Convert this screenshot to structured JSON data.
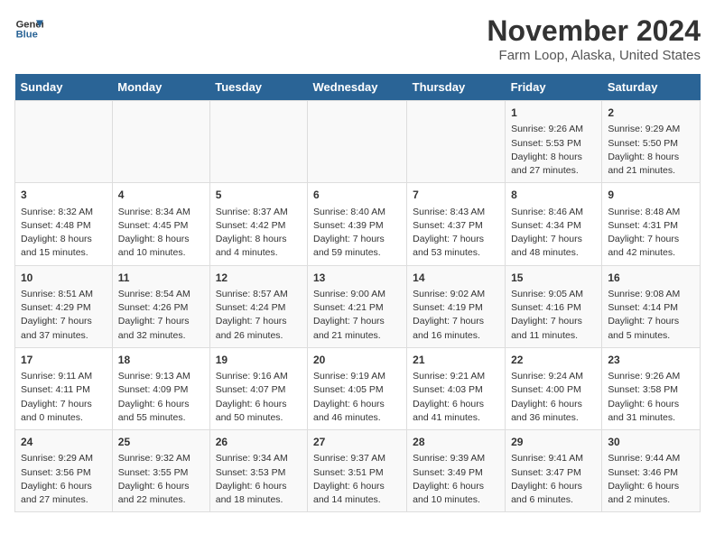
{
  "logo": {
    "line1": "General",
    "line2": "Blue"
  },
  "title": "November 2024",
  "subtitle": "Farm Loop, Alaska, United States",
  "days_header": [
    "Sunday",
    "Monday",
    "Tuesday",
    "Wednesday",
    "Thursday",
    "Friday",
    "Saturday"
  ],
  "weeks": [
    [
      {
        "day": "",
        "info": ""
      },
      {
        "day": "",
        "info": ""
      },
      {
        "day": "",
        "info": ""
      },
      {
        "day": "",
        "info": ""
      },
      {
        "day": "",
        "info": ""
      },
      {
        "day": "1",
        "info": "Sunrise: 9:26 AM\nSunset: 5:53 PM\nDaylight: 8 hours and 27 minutes."
      },
      {
        "day": "2",
        "info": "Sunrise: 9:29 AM\nSunset: 5:50 PM\nDaylight: 8 hours and 21 minutes."
      }
    ],
    [
      {
        "day": "3",
        "info": "Sunrise: 8:32 AM\nSunset: 4:48 PM\nDaylight: 8 hours and 15 minutes."
      },
      {
        "day": "4",
        "info": "Sunrise: 8:34 AM\nSunset: 4:45 PM\nDaylight: 8 hours and 10 minutes."
      },
      {
        "day": "5",
        "info": "Sunrise: 8:37 AM\nSunset: 4:42 PM\nDaylight: 8 hours and 4 minutes."
      },
      {
        "day": "6",
        "info": "Sunrise: 8:40 AM\nSunset: 4:39 PM\nDaylight: 7 hours and 59 minutes."
      },
      {
        "day": "7",
        "info": "Sunrise: 8:43 AM\nSunset: 4:37 PM\nDaylight: 7 hours and 53 minutes."
      },
      {
        "day": "8",
        "info": "Sunrise: 8:46 AM\nSunset: 4:34 PM\nDaylight: 7 hours and 48 minutes."
      },
      {
        "day": "9",
        "info": "Sunrise: 8:48 AM\nSunset: 4:31 PM\nDaylight: 7 hours and 42 minutes."
      }
    ],
    [
      {
        "day": "10",
        "info": "Sunrise: 8:51 AM\nSunset: 4:29 PM\nDaylight: 7 hours and 37 minutes."
      },
      {
        "day": "11",
        "info": "Sunrise: 8:54 AM\nSunset: 4:26 PM\nDaylight: 7 hours and 32 minutes."
      },
      {
        "day": "12",
        "info": "Sunrise: 8:57 AM\nSunset: 4:24 PM\nDaylight: 7 hours and 26 minutes."
      },
      {
        "day": "13",
        "info": "Sunrise: 9:00 AM\nSunset: 4:21 PM\nDaylight: 7 hours and 21 minutes."
      },
      {
        "day": "14",
        "info": "Sunrise: 9:02 AM\nSunset: 4:19 PM\nDaylight: 7 hours and 16 minutes."
      },
      {
        "day": "15",
        "info": "Sunrise: 9:05 AM\nSunset: 4:16 PM\nDaylight: 7 hours and 11 minutes."
      },
      {
        "day": "16",
        "info": "Sunrise: 9:08 AM\nSunset: 4:14 PM\nDaylight: 7 hours and 5 minutes."
      }
    ],
    [
      {
        "day": "17",
        "info": "Sunrise: 9:11 AM\nSunset: 4:11 PM\nDaylight: 7 hours and 0 minutes."
      },
      {
        "day": "18",
        "info": "Sunrise: 9:13 AM\nSunset: 4:09 PM\nDaylight: 6 hours and 55 minutes."
      },
      {
        "day": "19",
        "info": "Sunrise: 9:16 AM\nSunset: 4:07 PM\nDaylight: 6 hours and 50 minutes."
      },
      {
        "day": "20",
        "info": "Sunrise: 9:19 AM\nSunset: 4:05 PM\nDaylight: 6 hours and 46 minutes."
      },
      {
        "day": "21",
        "info": "Sunrise: 9:21 AM\nSunset: 4:03 PM\nDaylight: 6 hours and 41 minutes."
      },
      {
        "day": "22",
        "info": "Sunrise: 9:24 AM\nSunset: 4:00 PM\nDaylight: 6 hours and 36 minutes."
      },
      {
        "day": "23",
        "info": "Sunrise: 9:26 AM\nSunset: 3:58 PM\nDaylight: 6 hours and 31 minutes."
      }
    ],
    [
      {
        "day": "24",
        "info": "Sunrise: 9:29 AM\nSunset: 3:56 PM\nDaylight: 6 hours and 27 minutes."
      },
      {
        "day": "25",
        "info": "Sunrise: 9:32 AM\nSunset: 3:55 PM\nDaylight: 6 hours and 22 minutes."
      },
      {
        "day": "26",
        "info": "Sunrise: 9:34 AM\nSunset: 3:53 PM\nDaylight: 6 hours and 18 minutes."
      },
      {
        "day": "27",
        "info": "Sunrise: 9:37 AM\nSunset: 3:51 PM\nDaylight: 6 hours and 14 minutes."
      },
      {
        "day": "28",
        "info": "Sunrise: 9:39 AM\nSunset: 3:49 PM\nDaylight: 6 hours and 10 minutes."
      },
      {
        "day": "29",
        "info": "Sunrise: 9:41 AM\nSunset: 3:47 PM\nDaylight: 6 hours and 6 minutes."
      },
      {
        "day": "30",
        "info": "Sunrise: 9:44 AM\nSunset: 3:46 PM\nDaylight: 6 hours and 2 minutes."
      }
    ]
  ]
}
